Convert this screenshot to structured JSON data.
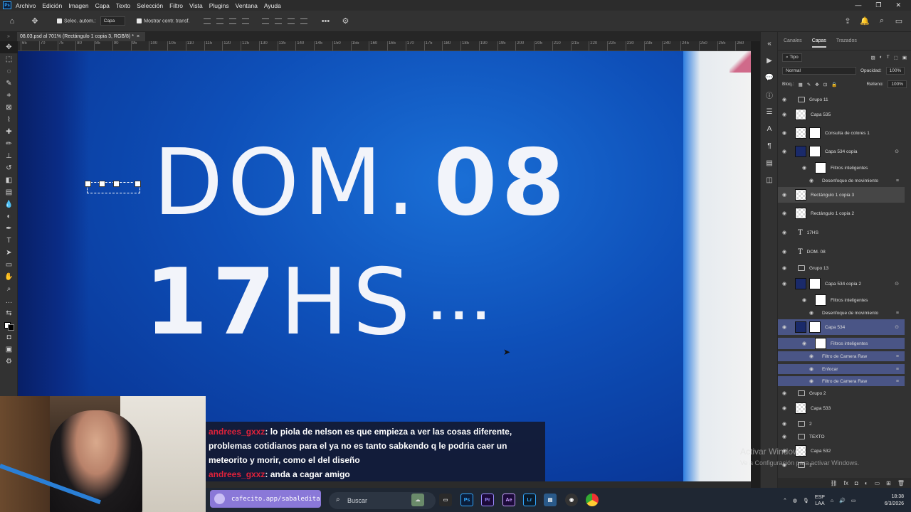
{
  "menubar": {
    "items": [
      "Archivo",
      "Edición",
      "Imagen",
      "Capa",
      "Texto",
      "Selección",
      "Filtro",
      "Vista",
      "Plugins",
      "Ventana",
      "Ayuda"
    ],
    "window_controls": [
      "—",
      "❐",
      "✕"
    ]
  },
  "optionsbar": {
    "auto_select_label": "Selec. autom.:",
    "auto_select_value": "Capa",
    "show_transform_label": "Mostrar contr. transf."
  },
  "document": {
    "tab_title": "08.03.psd al 701% (Rectángulo 1 copia 3, RGB/8) *",
    "close": "×"
  },
  "ruler": {
    "ticks": [
      "65",
      "70",
      "75",
      "80",
      "85",
      "90",
      "95",
      "100",
      "105",
      "110",
      "115",
      "120",
      "125",
      "130",
      "135",
      "140",
      "145",
      "150",
      "155",
      "160",
      "165",
      "170",
      "175",
      "180",
      "185",
      "190",
      "195",
      "200",
      "205",
      "210",
      "215",
      "220",
      "225",
      "230",
      "235",
      "240",
      "245",
      "250",
      "255",
      "260"
    ]
  },
  "canvas": {
    "line1_light": "DOM.",
    "line1_bold": "08",
    "line2_bold": "17",
    "line2_light": "HS",
    "line2_dots": "..."
  },
  "chat": {
    "messages": [
      {
        "user": "andrees_gxxz",
        "text": ": lo piola de nelson es que empieza a ver las cosas diferente, problemas cotidianos para el ya no es tanto sabkendo q le podria caer un meteorito y morir, como el del diseño"
      },
      {
        "user": "andrees_gxxz",
        "text": ": anda a cagar amigo"
      }
    ]
  },
  "layers_panel": {
    "tabs": [
      "Canales",
      "Capas",
      "Trazados"
    ],
    "active_tab": "Capas",
    "filter_label": "Tipo",
    "blend_mode": "Normal",
    "opacity_label": "Opacidad:",
    "opacity_value": "100%",
    "lock_label": "Bloq.:",
    "fill_label": "Relleno:",
    "fill_value": "100%",
    "layers": [
      {
        "name": "Grupo 11",
        "kind": "group"
      },
      {
        "name": "Capa 535",
        "kind": "layer"
      },
      {
        "name": "Consulta de colores 1",
        "kind": "adjustment"
      },
      {
        "name": "Capa 534 copia",
        "kind": "smart"
      },
      {
        "name": "Filtros inteligentes",
        "kind": "subfilter-head"
      },
      {
        "name": "Desenfoque de movimiento",
        "kind": "subfilter"
      },
      {
        "name": "Rectángulo 1 copia 3",
        "kind": "layer-hover"
      },
      {
        "name": "Rectángulo 1 copia 2",
        "kind": "layer"
      },
      {
        "name": "17HS",
        "kind": "text"
      },
      {
        "name": "DOM. 08",
        "kind": "text"
      },
      {
        "name": "Grupo 13",
        "kind": "group"
      },
      {
        "name": "Capa 534 copia 2",
        "kind": "smart"
      },
      {
        "name": "Filtros inteligentes",
        "kind": "subfilter-head"
      },
      {
        "name": "Desenfoque de movimiento",
        "kind": "subfilter"
      },
      {
        "name": "Capa 534",
        "kind": "smart-selected"
      },
      {
        "name": "Filtros inteligentes",
        "kind": "subfilter-head-selected"
      },
      {
        "name": "Filtro de Camera Raw",
        "kind": "subfilter-selected"
      },
      {
        "name": "Enfocar",
        "kind": "subfilter-selected"
      },
      {
        "name": "Filtro de Camera Raw",
        "kind": "subfilter-selected"
      },
      {
        "name": "Grupo 2",
        "kind": "group"
      },
      {
        "name": "Capa 533",
        "kind": "layer"
      },
      {
        "name": "2",
        "kind": "group"
      },
      {
        "name": "TEXTO",
        "kind": "group"
      },
      {
        "name": "Capa 532",
        "kind": "layer"
      },
      {
        "name": "1",
        "kind": "group"
      }
    ]
  },
  "watermark": {
    "title": "Activar Windows",
    "subtitle": "Ve a Configuración para activar Windows."
  },
  "taskbar": {
    "cafecito": "cafecito.app/sabaledita",
    "search_placeholder": "Buscar",
    "apps": [
      "Ps",
      "Pr",
      "Ae",
      "Lr"
    ],
    "lang": "ESP",
    "lang2": "LAA",
    "time": "18:38",
    "date": "6/3/2026"
  }
}
